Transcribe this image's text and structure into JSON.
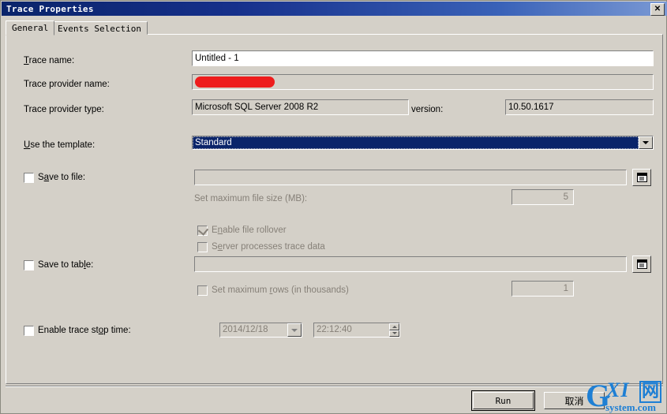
{
  "window": {
    "title": "Trace Properties",
    "close_label": "✕"
  },
  "tabs": [
    {
      "label": "General",
      "active": true
    },
    {
      "label": "Events Selection",
      "active": false
    }
  ],
  "form": {
    "trace_name": {
      "label": "Trace name:",
      "value": "Untitled - 1"
    },
    "trace_provider_name": {
      "label": "Trace provider name:",
      "value": "",
      "redaction_color": "#ee1c1c"
    },
    "trace_provider_type": {
      "label": "Trace provider type:",
      "value": "Microsoft SQL Server 2008 R2"
    },
    "version": {
      "label": "version:",
      "value": "10.50.1617"
    },
    "template": {
      "label": "Use the template:",
      "value": "Standard"
    },
    "save_to_file": {
      "label": "Save to file:",
      "checked": false,
      "path_value": "",
      "max_file_size": {
        "label": "Set maximum file size (MB):",
        "value": "5"
      },
      "enable_file_rollover": {
        "label": "Enable file rollover",
        "checked": true
      },
      "server_processes_trace_data": {
        "label": "Server processes trace data",
        "checked": false
      }
    },
    "save_to_table": {
      "label": "Save to table:",
      "checked": false,
      "table_value": "",
      "max_rows": {
        "label": "Set maximum rows (in thousands)",
        "checked": false,
        "value": "1"
      }
    },
    "enable_trace_stop_time": {
      "label": "Enable trace stop time:",
      "checked": false,
      "date_value": "2014/12/18",
      "time_value": "22:12:40"
    }
  },
  "footer": {
    "run_label": "Run",
    "cancel_label": "取消"
  },
  "watermark": {
    "g": "G",
    "xi": "XI",
    "cn": "网",
    "sub": "system.com"
  }
}
